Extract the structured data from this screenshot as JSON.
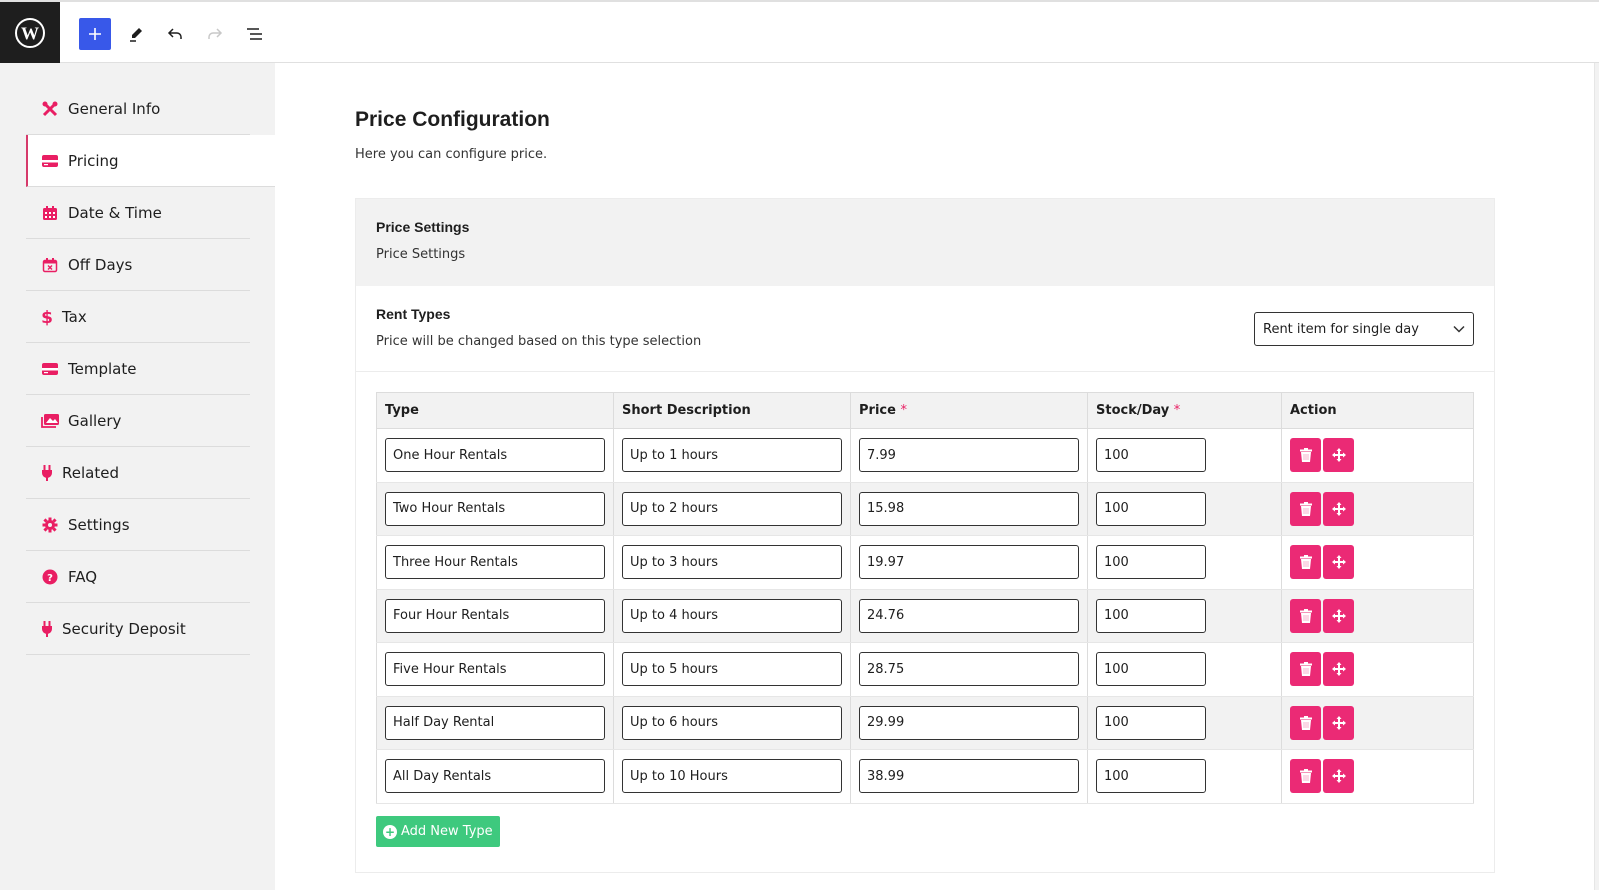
{
  "toolbar": {
    "logo": "wordpress-logo",
    "buttons": [
      {
        "name": "add-block-button",
        "icon": "plus-icon"
      },
      {
        "name": "edit-tool-button",
        "icon": "pencil-icon"
      },
      {
        "name": "undo-button",
        "icon": "undo-icon"
      },
      {
        "name": "redo-button",
        "icon": "redo-icon"
      },
      {
        "name": "document-overview-button",
        "icon": "list-icon"
      }
    ]
  },
  "sidebar": {
    "items": [
      {
        "label": "General Info",
        "icon": "tools-icon"
      },
      {
        "label": "Pricing",
        "icon": "credit-card-icon",
        "active": true
      },
      {
        "label": "Date & Time",
        "icon": "calendar-icon"
      },
      {
        "label": "Off Days",
        "icon": "calendar-x-icon"
      },
      {
        "label": "Tax",
        "icon": "dollar-icon"
      },
      {
        "label": "Template",
        "icon": "credit-card-icon"
      },
      {
        "label": "Gallery",
        "icon": "images-icon"
      },
      {
        "label": "Related",
        "icon": "plug-icon"
      },
      {
        "label": "Settings",
        "icon": "gear-icon"
      },
      {
        "label": "FAQ",
        "icon": "question-circle-icon"
      },
      {
        "label": "Security Deposit",
        "icon": "plug-icon"
      }
    ]
  },
  "main": {
    "title": "Price Configuration",
    "subtitle": "Here you can configure price.",
    "price_settings": {
      "title": "Price Settings",
      "description": "Price Settings"
    },
    "rent_types": {
      "title": "Rent Types",
      "description": "Price will be changed based on this type selection",
      "selected": "Rent item for single day"
    },
    "table": {
      "headers": {
        "type": "Type",
        "description": "Short Description",
        "price": "Price",
        "stock": "Stock/Day",
        "action": "Action",
        "required_mark": "*"
      },
      "rows": [
        {
          "type": "One Hour Rentals",
          "description": "Up to 1 hours",
          "price": "7.99",
          "stock": "100"
        },
        {
          "type": "Two Hour Rentals",
          "description": "Up to 2 hours",
          "price": "15.98",
          "stock": "100"
        },
        {
          "type": "Three Hour Rentals",
          "description": "Up to 3 hours",
          "price": "19.97",
          "stock": "100"
        },
        {
          "type": "Four Hour Rentals",
          "description": "Up to 4 hours",
          "price": "24.76",
          "stock": "100"
        },
        {
          "type": "Five Hour Rentals",
          "description": "Up to 5 hours",
          "price": "28.75",
          "stock": "100"
        },
        {
          "type": "Half Day Rental",
          "description": "Up to 6 hours",
          "price": "29.99",
          "stock": "100"
        },
        {
          "type": "All Day Rentals",
          "description": "Up to 10 Hours",
          "price": "38.99",
          "stock": "100"
        }
      ]
    },
    "add_button": "Add New Type"
  },
  "colors": {
    "accent": "#eb2a75",
    "sidebar_icon": "#e91e63",
    "add_button": "#3ec97e",
    "toolbar_primary": "#3858e9"
  }
}
